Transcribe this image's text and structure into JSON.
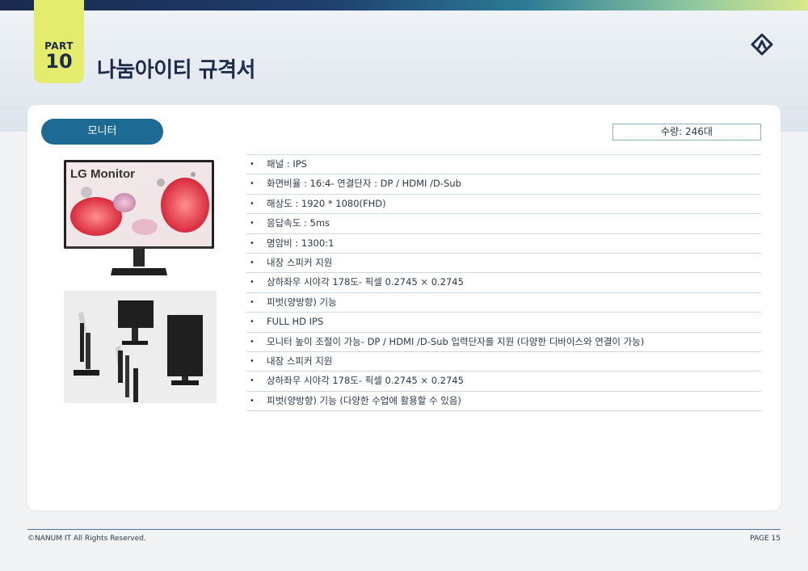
{
  "header": {
    "part_label": "PART",
    "part_number": "10",
    "title": "나눔아이티 규격서",
    "logo_icon": "nanum-logo-icon"
  },
  "product": {
    "category": "모니터",
    "quantity": "수량: 246대",
    "images": [
      "monitor-front-image",
      "monitor-angles-image"
    ],
    "monitor_brand_text": "LG Monitor",
    "specs": [
      "패널 : IPS",
      "화면비율 : 16:4- 연결단자 : DP / HDMI /D-Sub",
      "해상도 : 1920 * 1080(FHD)",
      "응답속도 : 5ms",
      "명암비 : 1300:1",
      "내장 스피커 지원",
      "상하좌우 시야각 178도- 픽셀 0.2745 × 0.2745",
      "피벗(양방향) 기능",
      "FULL HD IPS",
      "모니터 높이 조절이 가능- DP / HDMI /D-Sub 입력단자를 지원 (다양한 디바이스와 연결이 가능)",
      "내장 스피커 지원",
      "상하좌우 시야각 178도- 픽셀 0.2745 × 0.2745",
      "피벗(양방향) 기능 (다양한 수업에 활용할 수 있음)"
    ],
    "bullet": "•"
  },
  "footer": {
    "copyright": "©NANUM IT All Rights Reserved.",
    "page": "PAGE 15"
  },
  "colors": {
    "accent_yellow": "#e3ec6c",
    "navy": "#1c2b4a",
    "pill_blue": "#1d6b95"
  }
}
